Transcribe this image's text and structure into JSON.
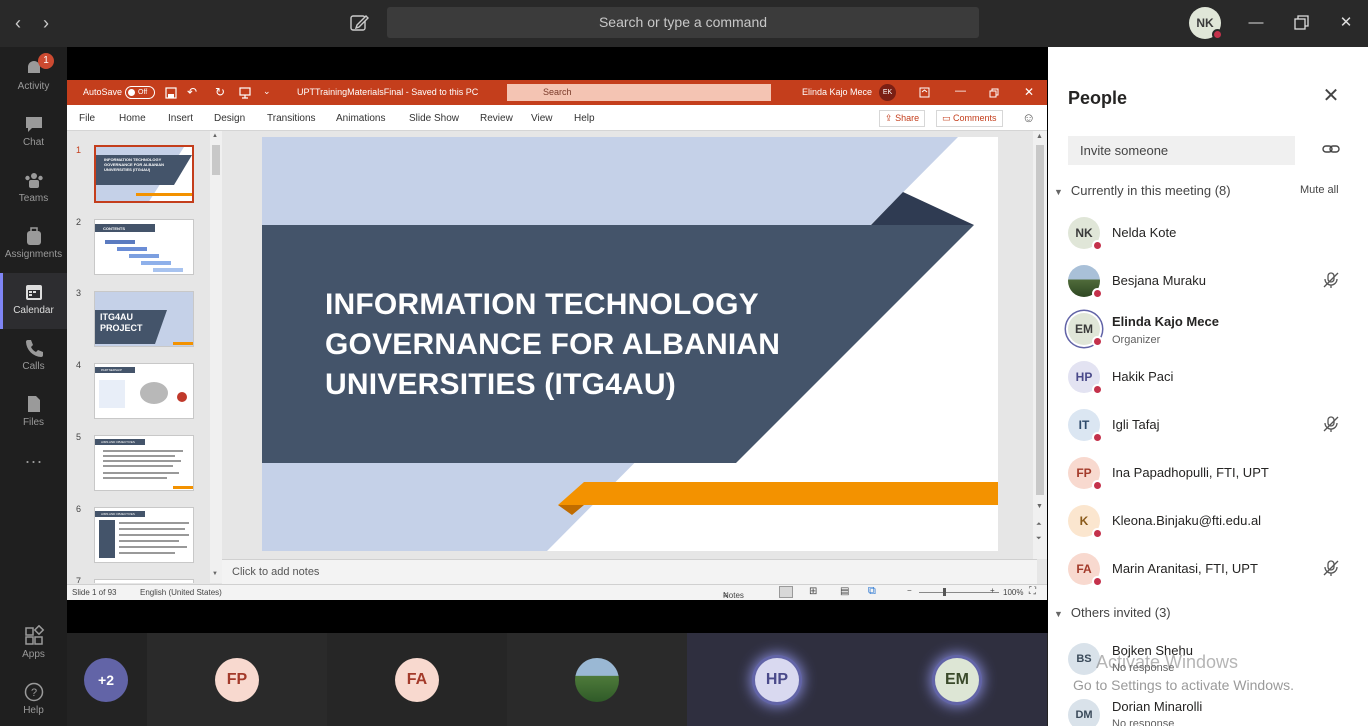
{
  "titlebar": {
    "search_placeholder": "Search or type a command",
    "user_initials": "NK"
  },
  "rail": {
    "items": [
      {
        "label": "Activity",
        "badge": "1"
      },
      {
        "label": "Chat"
      },
      {
        "label": "Teams"
      },
      {
        "label": "Assignments"
      },
      {
        "label": "Calendar"
      },
      {
        "label": "Calls"
      },
      {
        "label": "Files"
      },
      {
        "label": "Apps"
      },
      {
        "label": "Help"
      }
    ]
  },
  "ppt": {
    "autosave": "AutoSave",
    "autosave_state": "Off",
    "doc_title": "UPTTrainingMaterialsFinal  -  Saved to this PC",
    "search": "Search",
    "user": "Elinda Kajo Mece",
    "user_initials": "EK",
    "tabs": [
      "File",
      "Home",
      "Insert",
      "Design",
      "Transitions",
      "Animations",
      "Slide Show",
      "Review",
      "View",
      "Help"
    ],
    "share": "Share",
    "comments": "Comments",
    "thumb_numbers": [
      "1",
      "2",
      "3",
      "4",
      "5",
      "6",
      "7"
    ],
    "thumb1_text": "INFORMATION TECHNOLOGY GOVERNANCE FOR ALBANIAN UNIVERSITIES (ITG4AU)",
    "thumb2_text": "CONTENTS",
    "thumb3_text": "ITG4AU PROJECT",
    "thumb4_text": "PARTNERSHIP",
    "thumb5_text": "AIMS AND OBJECTIVES",
    "thumb6_text": "AIMS AND OBJECTIVES",
    "slide_title": "INFORMATION TECHNOLOGY GOVERNANCE FOR ALBANIAN UNIVERSITIES (ITG4AU)",
    "notes_placeholder": "Click to add notes",
    "status_slide": "Slide 1 of 93",
    "status_lang": "English (United States)",
    "status_notes": "Notes",
    "zoom": "100%"
  },
  "strip": {
    "overflow": "+2",
    "tiles": [
      {
        "initials": "FP"
      },
      {
        "initials": "FA"
      },
      {
        "initials": ""
      },
      {
        "initials": "HP"
      },
      {
        "initials": "EM"
      }
    ]
  },
  "people": {
    "title": "People",
    "invite_placeholder": "Invite someone",
    "in_meeting_label": "Currently in this meeting (8)",
    "mute_all": "Mute all",
    "members": [
      {
        "initials": "NK",
        "name": "Nelda Kote",
        "sub": "",
        "muted": false
      },
      {
        "initials": "",
        "name": "Besjana Muraku",
        "sub": "",
        "muted": true
      },
      {
        "initials": "EM",
        "name": "Elinda Kajo Mece",
        "sub": "Organizer",
        "muted": false
      },
      {
        "initials": "HP",
        "name": "Hakik Paci",
        "sub": "",
        "muted": false
      },
      {
        "initials": "IT",
        "name": "Igli Tafaj",
        "sub": "",
        "muted": true
      },
      {
        "initials": "FP",
        "name": "Ina Papadhopulli, FTI, UPT",
        "sub": "",
        "muted": false
      },
      {
        "initials": "K",
        "name": "Kleona.Binjaku@fti.edu.al",
        "sub": "",
        "muted": false
      },
      {
        "initials": "FA",
        "name": "Marin Aranitasi, FTI, UPT",
        "sub": "",
        "muted": true
      }
    ],
    "others_label": "Others invited (3)",
    "invited": [
      {
        "initials": "BS",
        "name": "Bojken Shehu",
        "sub": "No response"
      },
      {
        "initials": "DM",
        "name": "Dorian Minarolli",
        "sub": "No response"
      }
    ],
    "watermark_line1": "Activate Windows",
    "watermark_line2": "Go to Settings to activate Windows."
  },
  "colors": {
    "teams_purple": "#6264a7",
    "ppt_orange": "#c43e1c",
    "slide_navy": "#44546a",
    "slide_orange": "#f39200",
    "presence_busy": "#c4314b"
  }
}
